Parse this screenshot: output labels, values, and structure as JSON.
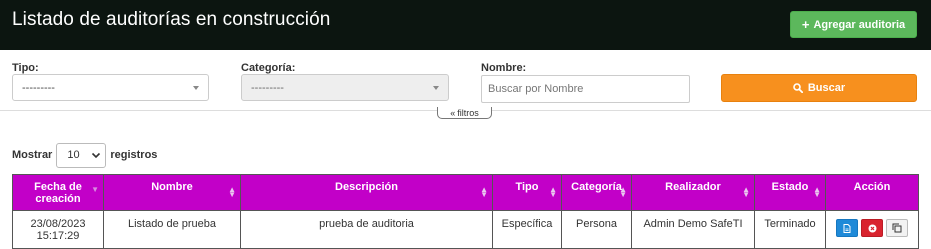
{
  "header": {
    "title": "Listado de auditorías en construcción",
    "add_button": "Agregar auditoria"
  },
  "filters": {
    "tipo": {
      "label": "Tipo:",
      "value": "---------"
    },
    "categoria": {
      "label": "Categoría:",
      "value": "---------"
    },
    "nombre": {
      "label": "Nombre:",
      "placeholder": "Buscar por Nombre"
    },
    "search_button": "Buscar",
    "toggle_label": "filtros"
  },
  "length": {
    "prefix": "Mostrar",
    "value": "10",
    "suffix": "registros"
  },
  "table": {
    "headers": [
      "Fecha de creación",
      "Nombre",
      "Descripción",
      "Tipo",
      "Categoría",
      "Realizador",
      "Estado",
      "Acción"
    ],
    "rows": [
      {
        "fecha_date": "23/08/2023",
        "fecha_time": "15:17:29",
        "nombre": "Listado de prueba",
        "descripcion": "prueba de auditoria",
        "tipo": "Específica",
        "categoria": "Persona",
        "realizador": "Admin Demo SafeTI",
        "estado": "Terminado"
      }
    ]
  },
  "colors": {
    "header_bg": "#0c1510",
    "table_header": "#c200c8",
    "add_button": "#5cb85c",
    "search_button": "#f7901e",
    "view_button": "#1f8ad8",
    "delete_button": "#d9232e"
  }
}
